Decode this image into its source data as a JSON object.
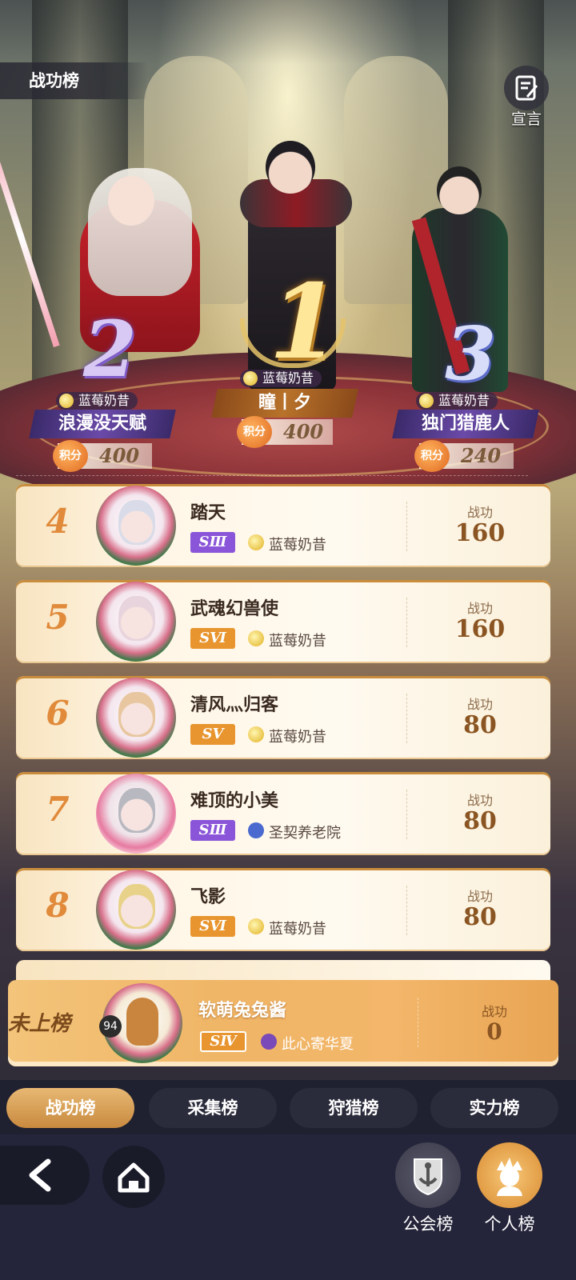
{
  "header": {
    "title": "战功榜",
    "declare_label": "宣言"
  },
  "podium": {
    "first": {
      "rank": "1",
      "guild": "蓝莓奶昔",
      "name": "瞳丨夕",
      "score_label": "积分",
      "score": "400"
    },
    "second": {
      "rank": "2",
      "guild": "蓝莓奶昔",
      "name": "浪漫没天赋",
      "score_label": "积分",
      "score": "400"
    },
    "third": {
      "rank": "3",
      "guild": "蓝莓奶昔",
      "name": "独门猎鹿人",
      "score_label": "积分",
      "score": "240"
    }
  },
  "rankings": [
    {
      "rank": "4",
      "name": "踏天",
      "tier": "SⅢ",
      "tier_color": "#8a55d8",
      "guild": "蓝莓奶昔",
      "guild_icon_color": "#e0b020",
      "stat_label": "战功",
      "stat": "160"
    },
    {
      "rank": "5",
      "name": "武魂幻兽使",
      "tier": "SⅥ",
      "tier_color": "#e8952f",
      "guild": "蓝莓奶昔",
      "guild_icon_color": "#e0b020",
      "stat_label": "战功",
      "stat": "160"
    },
    {
      "rank": "6",
      "name": "清风灬归客",
      "tier": "SⅤ",
      "tier_color": "#e8952f",
      "guild": "蓝莓奶昔",
      "guild_icon_color": "#e0b020",
      "stat_label": "战功",
      "stat": "80"
    },
    {
      "rank": "7",
      "name": "难顶的小美",
      "tier": "SⅢ",
      "tier_color": "#8a55d8",
      "guild": "圣契养老院",
      "guild_icon_color": "#4a6ad0",
      "stat_label": "战功",
      "stat": "80"
    },
    {
      "rank": "8",
      "name": "飞影",
      "tier": "SⅥ",
      "tier_color": "#e8952f",
      "guild": "蓝莓奶昔",
      "guild_icon_color": "#e0b020",
      "stat_label": "战功",
      "stat": "80"
    }
  ],
  "self": {
    "rank_text": "未上榜",
    "level": "94",
    "name": "软萌兔兔酱",
    "tier": "SⅣ",
    "tier_color": "#e8952f",
    "guild": "此心寄华夏",
    "stat_label": "战功",
    "stat": "0"
  },
  "tabs": [
    "战功榜",
    "采集榜",
    "狩猎榜",
    "实力榜"
  ],
  "active_tab": "战功榜",
  "footer": {
    "guild_board_label": "公会榜",
    "personal_board_label": "个人榜"
  },
  "colors": {
    "accent_gold": "#c98a3f",
    "rank_number": "#e08a3a",
    "stat_value": "#8a5522"
  },
  "icons": [
    "declare-icon",
    "back-arrow-icon",
    "home-icon",
    "guild-board-icon",
    "personal-board-icon",
    "guild-emblem-icon",
    "score-badge-icon"
  ]
}
